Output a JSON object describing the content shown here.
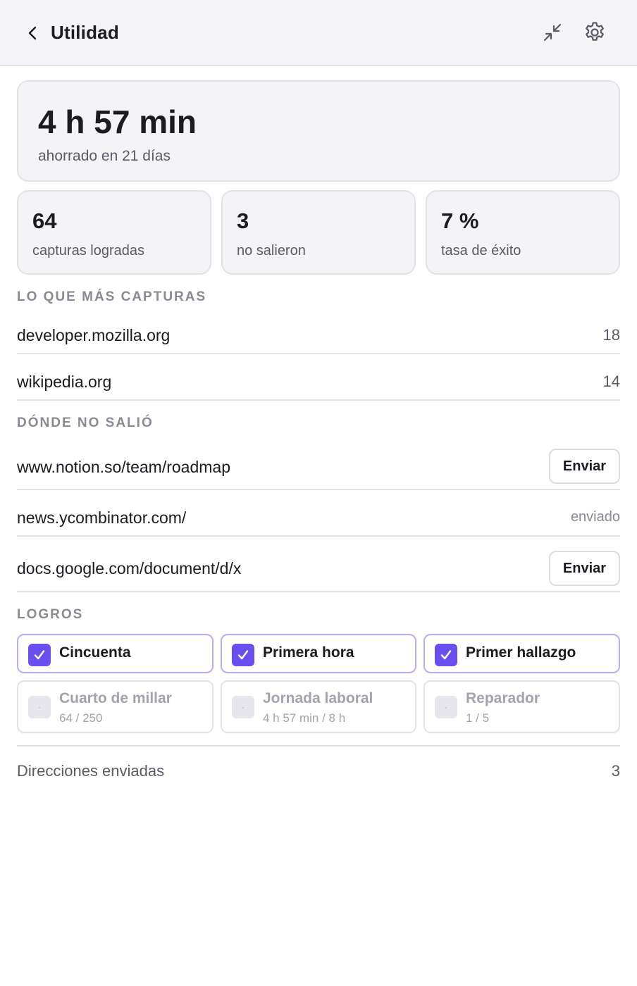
{
  "header": {
    "title": "Utilidad",
    "back_icon": "chevron-left-icon",
    "collapse_icon": "collapse-icon",
    "settings_icon": "gear-icon"
  },
  "summary": {
    "saved_time": "4 h 57 min",
    "saved_caption": "ahorrado en 21 días"
  },
  "stats": [
    {
      "value": "64",
      "label": "capturas logradas"
    },
    {
      "value": "3",
      "label": "no salieron"
    },
    {
      "value": "7 %",
      "label": "tasa de éxito"
    }
  ],
  "top_captures": {
    "heading": "LO QUE MÁS CAPTURAS",
    "items": [
      {
        "site": "developer.mozilla.org",
        "count": "18"
      },
      {
        "site": "wikipedia.org",
        "count": "14"
      }
    ]
  },
  "failures": {
    "heading": "DÓNDE NO SALIÓ",
    "items": [
      {
        "url": "www.notion.so/team/roadmap",
        "action": "Enviar"
      },
      {
        "url": "news.ycombinator.com/",
        "status": "enviado"
      },
      {
        "url": "docs.google.com/document/d/x",
        "action": "Enviar"
      }
    ]
  },
  "achievements": {
    "heading": "LOGROS",
    "unlocked": [
      {
        "title": "Cincuenta"
      },
      {
        "title": "Primera hora"
      },
      {
        "title": "Primer hallazgo"
      }
    ],
    "locked": [
      {
        "title": "Cuarto de millar",
        "progress": "64 / 250",
        "progress_fraction": 0.256
      },
      {
        "title": "Jornada laboral",
        "progress": "4 h 57 min / 8 h",
        "progress_fraction": 0.619
      },
      {
        "title": "Reparador",
        "progress": "1 / 5",
        "progress_fraction": 0.2
      }
    ]
  },
  "footer": {
    "label": "Direcciones enviadas",
    "value": "3"
  },
  "colors": {
    "accent": "#6a4ff0",
    "accent_border": "#b7aef2",
    "header_bg": "#f5f5f8",
    "card_bg": "#f4f4f7"
  }
}
